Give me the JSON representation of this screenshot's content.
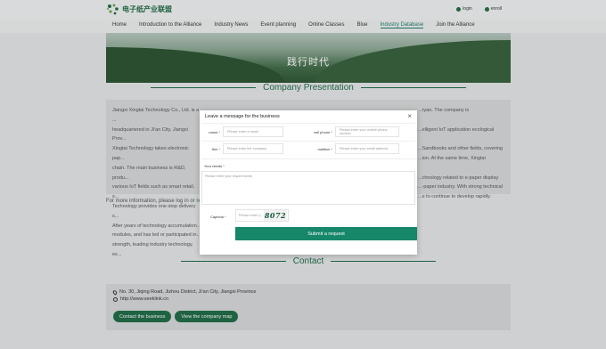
{
  "header": {
    "logo_text": "电子纸产业联盟",
    "links": [
      {
        "label": "login",
        "icon": "user-icon"
      },
      {
        "label": "enroll",
        "icon": "user-add-icon"
      }
    ]
  },
  "nav": {
    "items": [
      {
        "label": "Home"
      },
      {
        "label": "Introduction to the Alliance"
      },
      {
        "label": "Industry News"
      },
      {
        "label": "Event planning"
      },
      {
        "label": "Online Classes"
      },
      {
        "label": "Blue"
      },
      {
        "label": "Industry Database",
        "active": true
      },
      {
        "label": "Join the Alliance"
      }
    ]
  },
  "banner": {
    "title": "践行时代"
  },
  "company": {
    "title": "Company Presentation",
    "lines": [
      "Jiangxi Xingtai Technology Co., Ltd. is a ...",
      "headquartered in Ji'an City, Jiangxi Prov...",
      "Xingtai Technology takes electronic pap...",
      "chain. The main business is R&D, produ...",
      "various IoT fields such as smart retail, s...",
      "Technology provides one-stop delivery s...",
      "After years of technology accumulation...",
      "modules, and has led or participated in...",
      "strength, leading industry technology, ex..."
    ],
    "right_lines": [
      "...ryan. The company is",
      "",
      "...elligent IoT application ecological",
      "",
      "...Sandbooks and other fields, covering",
      "...ion. At the same time, Xingtai",
      "",
      "...chnology related to e-paper display",
      "...-paper industry. With strong technical",
      "...e to continue to develop rapidly."
    ],
    "more_info_prefix": "For more information, please log in or",
    "more_info_link": "re..."
  },
  "modal": {
    "title": "Leave a message for the business",
    "close": "×",
    "fields": {
      "name": {
        "label": "name",
        "placeholder": "Please enter a name"
      },
      "cell_phone": {
        "label": "cell phone",
        "placeholder": "Please enter your mobile phone number"
      },
      "firm": {
        "label": "firm",
        "placeholder": "Please enter the company"
      },
      "mailbox": {
        "label": "mailbox",
        "placeholder": "Please enter your email address"
      }
    },
    "needs_label": "Your needs",
    "needs_placeholder": "Please enter your requirements",
    "captcha_label": "Captcha",
    "captcha_placeholder": "Please enter y...",
    "captcha_code": "8072",
    "submit_label": "Submit a request",
    "required_mark": "*"
  },
  "contact": {
    "title": "Contact",
    "address": "No. 30, Jiqing Road, Jizhou District, Ji'an City, Jiangxi Province",
    "website": "http://www.seeklink.cn",
    "buttons": [
      "Contact the business",
      "View the company map"
    ]
  }
}
